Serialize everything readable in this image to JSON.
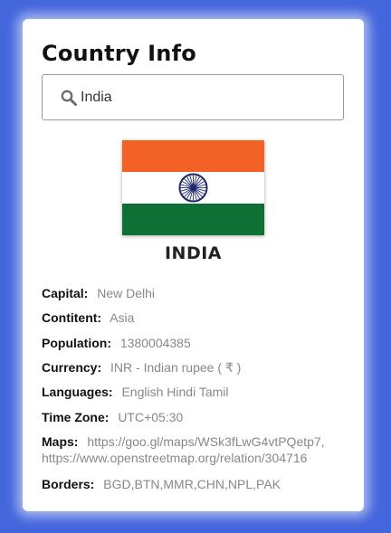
{
  "header": {
    "title": "Country Info"
  },
  "search": {
    "value": "India",
    "icon": "search-icon"
  },
  "flag": {
    "colors": {
      "saffron": "#f26226",
      "white": "#ffffff",
      "green": "#0f7036",
      "chakra": "#1f2a6b"
    }
  },
  "country": {
    "name": "INDIA"
  },
  "details": {
    "capital_label": "Capital:",
    "capital": "New Delhi",
    "continent_label": "Contitent:",
    "continent": "Asia",
    "population_label": "Population:",
    "population": "1380004385",
    "currency_label": "Currency:",
    "currency": "INR - Indian rupee ( ₹ )",
    "languages_label": "Languages:",
    "languages": "English Hindi Tamil",
    "timezone_label": "Time Zone:",
    "timezone": "UTC+05:30",
    "maps_label": "Maps:",
    "maps_google": "https://goo.gl/maps/WSk3fLwG4vtPQetp7,",
    "maps_osm": "https://www.openstreetmap.org/relation/304716",
    "borders_label": "Borders:",
    "borders": "BGD,BTN,MMR,CHN,NPL,PAK"
  },
  "theme": {
    "background": "#4466dd",
    "card": "#ffffff"
  }
}
